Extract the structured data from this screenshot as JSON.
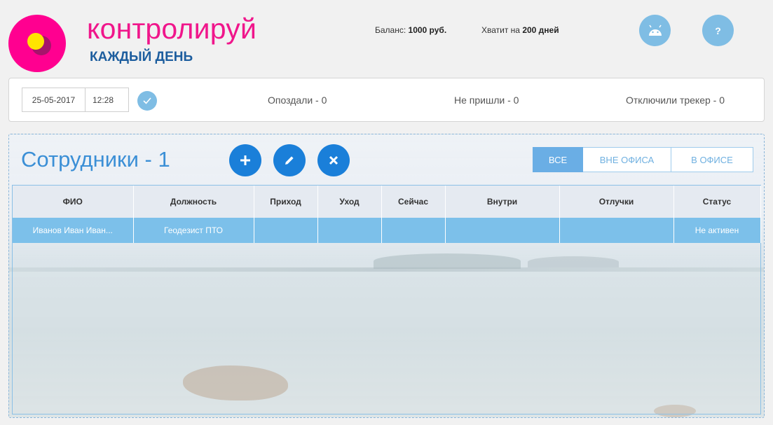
{
  "brand": {
    "title": "контролируй",
    "subtitle": "КАЖДЫЙ ДЕНЬ"
  },
  "header": {
    "balance_label": "Баланс:",
    "balance_value": "1000 руб.",
    "enough_label": "Хватит на",
    "enough_value": "200 дней",
    "help_label": "?"
  },
  "statusbar": {
    "date": "25-05-2017",
    "time": "12:28",
    "late": "Опоздали - 0",
    "absent": "Не пришли - 0",
    "tracker_off": "Отключили трекер - 0"
  },
  "employees": {
    "title": "Сотрудники - 1",
    "filters": {
      "all": "ВСЕ",
      "out_of_office": "ВНЕ ОФИСА",
      "in_office": "В ОФИСЕ"
    },
    "columns": [
      "ФИО",
      "Должность",
      "Приход",
      "Уход",
      "Сейчас",
      "Внутри",
      "Отлучки",
      "Статус"
    ],
    "rows": [
      [
        "Иванов Иван Иван...",
        "Геодезист ПТО",
        "",
        "",
        "",
        "",
        "",
        "Не активен"
      ]
    ]
  },
  "colors": {
    "brand_pink": "#f0168b",
    "brand_blue": "#1c5d9e",
    "accent_blue": "#1a7fd9",
    "light_blue": "#7fbde4",
    "row_blue": "#7cc0ea"
  },
  "icons": {
    "android": "android-icon",
    "check": "check-icon",
    "add": "plus-icon",
    "edit": "pencil-icon",
    "delete": "close-icon"
  }
}
